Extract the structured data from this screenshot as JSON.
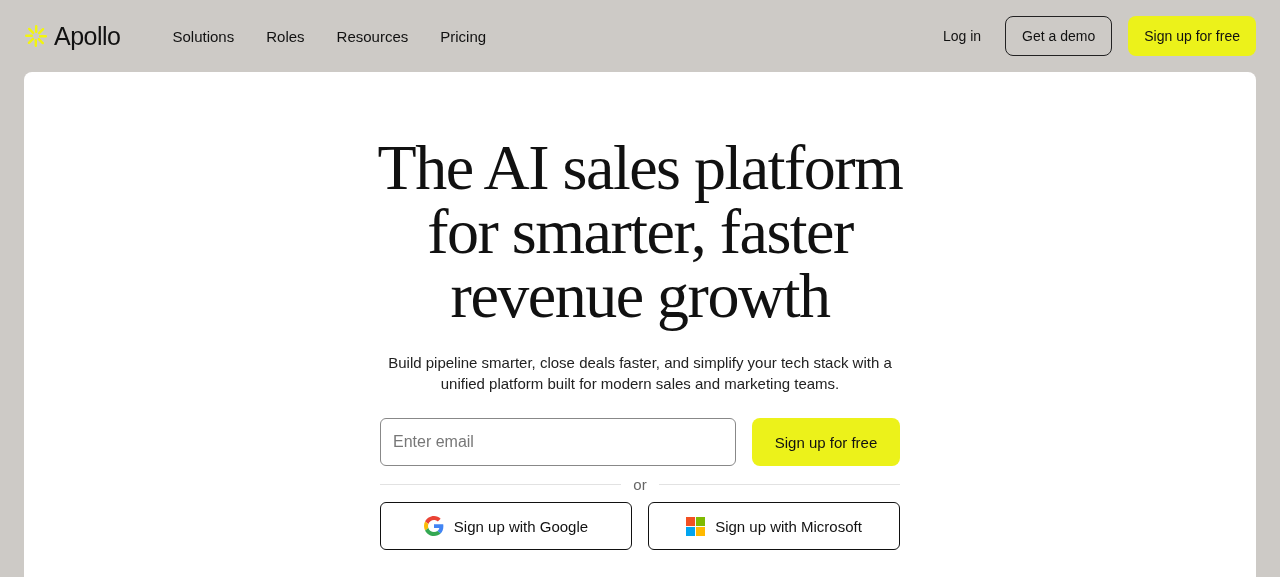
{
  "header": {
    "logo": "Apollo",
    "nav": [
      "Solutions",
      "Roles",
      "Resources",
      "Pricing"
    ],
    "login": "Log in",
    "demo": "Get a demo",
    "signup": "Sign up for free"
  },
  "hero": {
    "title": [
      "The AI sales platform",
      "for smarter, faster",
      "revenue growth"
    ],
    "subtitle": "Build pipeline smarter, close deals faster, and simplify your tech stack with a unified platform built for modern sales and marketing teams.",
    "email": {
      "placeholder": "Enter email"
    },
    "submit": "Sign up for free",
    "divider": "or",
    "social": [
      {
        "kind": "google",
        "label": "Sign up with Google"
      },
      {
        "kind": "microsoft",
        "label": "Sign up with Microsoft"
      }
    ]
  }
}
